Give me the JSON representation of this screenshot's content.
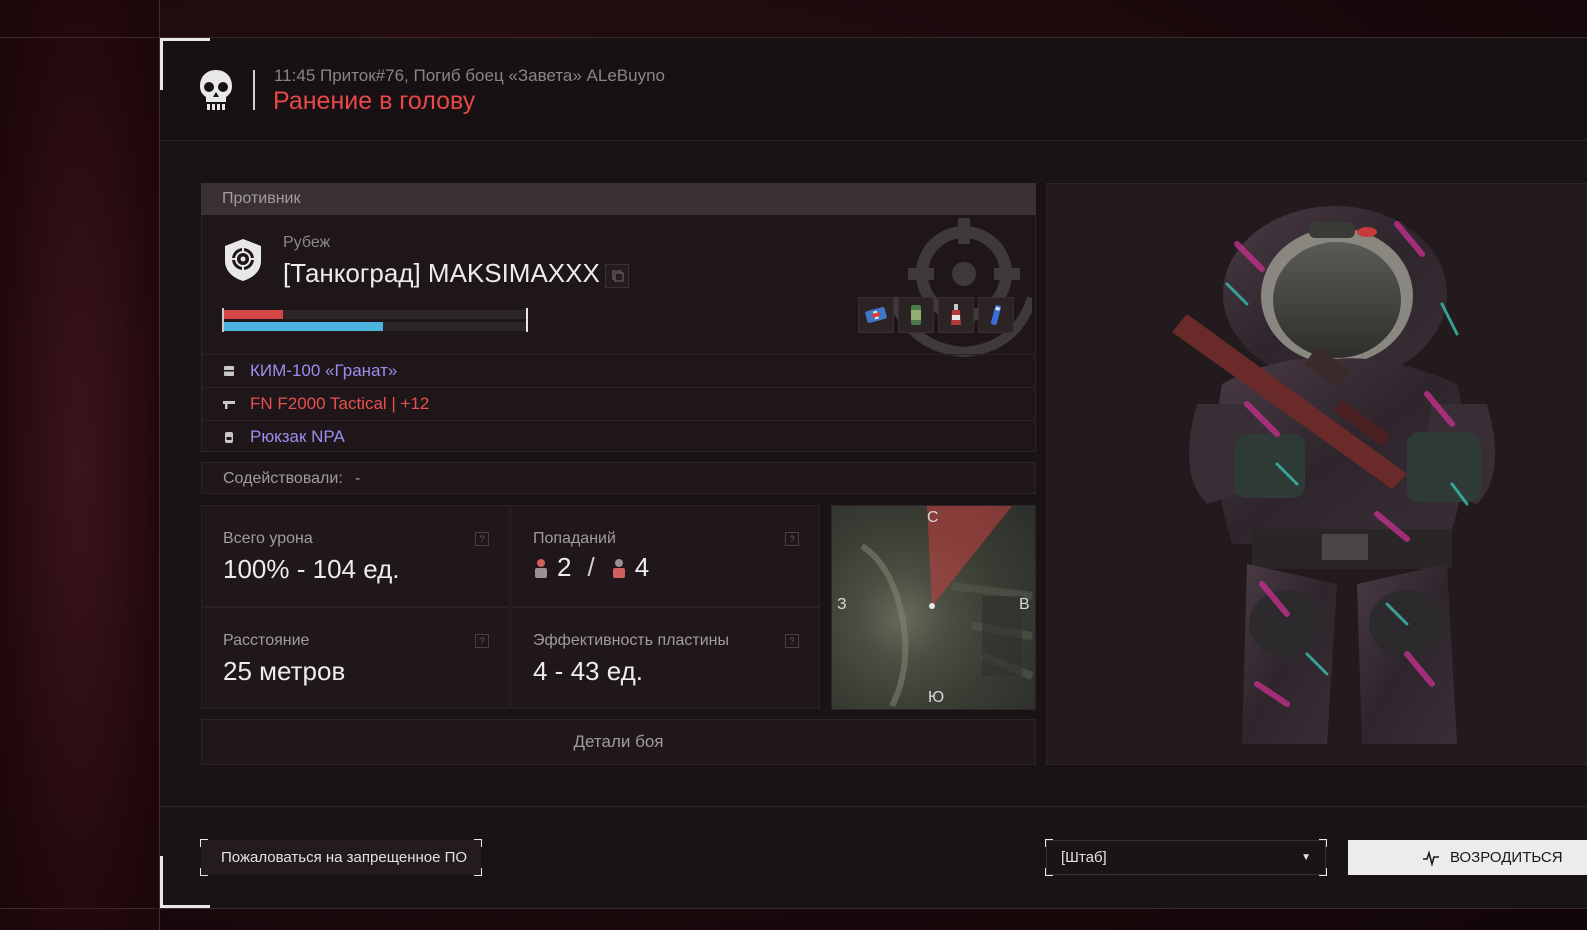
{
  "header": {
    "subtitle": "11:45 Приток#76, Погиб боец «Завета» ALeBuyno",
    "title": "Ранение в голову"
  },
  "enemy": {
    "section_label": "Противник",
    "faction": "Рубеж",
    "name": "[Танкоград] MAKSIMAXXX",
    "health_fraction": 0.2,
    "armor_fraction": 0.53,
    "quick_items": [
      "medkit-icon",
      "canister-icon",
      "bottle-icon",
      "injector-icon"
    ],
    "gear": [
      {
        "icon": "armor-icon",
        "label": "КИМ-100 «Гранат»",
        "color": "#9a8ff0"
      },
      {
        "icon": "rifle-icon",
        "label": "FN F2000 Tactical | +12",
        "color": "#e85050"
      },
      {
        "icon": "backpack-icon",
        "label": "Рюкзак NPA",
        "color": "#9a8ff0"
      }
    ]
  },
  "assist": {
    "label": "Содействовали:",
    "value": "-"
  },
  "stats": {
    "damage": {
      "label": "Всего урона",
      "value": "100% - 104 ед."
    },
    "hits": {
      "label": "Попаданий",
      "first": "2",
      "separator": "/",
      "second": "4"
    },
    "distance": {
      "label": "Расстояние",
      "value": "25 метров"
    },
    "plate": {
      "label": "Эффективность пластины",
      "value": "4 - 43 ед."
    },
    "help_glyph": "?"
  },
  "minimap": {
    "north": "С",
    "west": "З",
    "east": "В",
    "south": "Ю"
  },
  "details_button": "Детали боя",
  "footer": {
    "report_button": "Пожаловаться на запрещенное ПО",
    "spawn_select": "[Штаб]",
    "respawn_button": "ВОЗРОДИТЬСЯ"
  },
  "colors": {
    "accent_red": "#e84848",
    "health": "#d64545",
    "armor": "#4ab3de",
    "gear_purple": "#9a8ff0"
  }
}
